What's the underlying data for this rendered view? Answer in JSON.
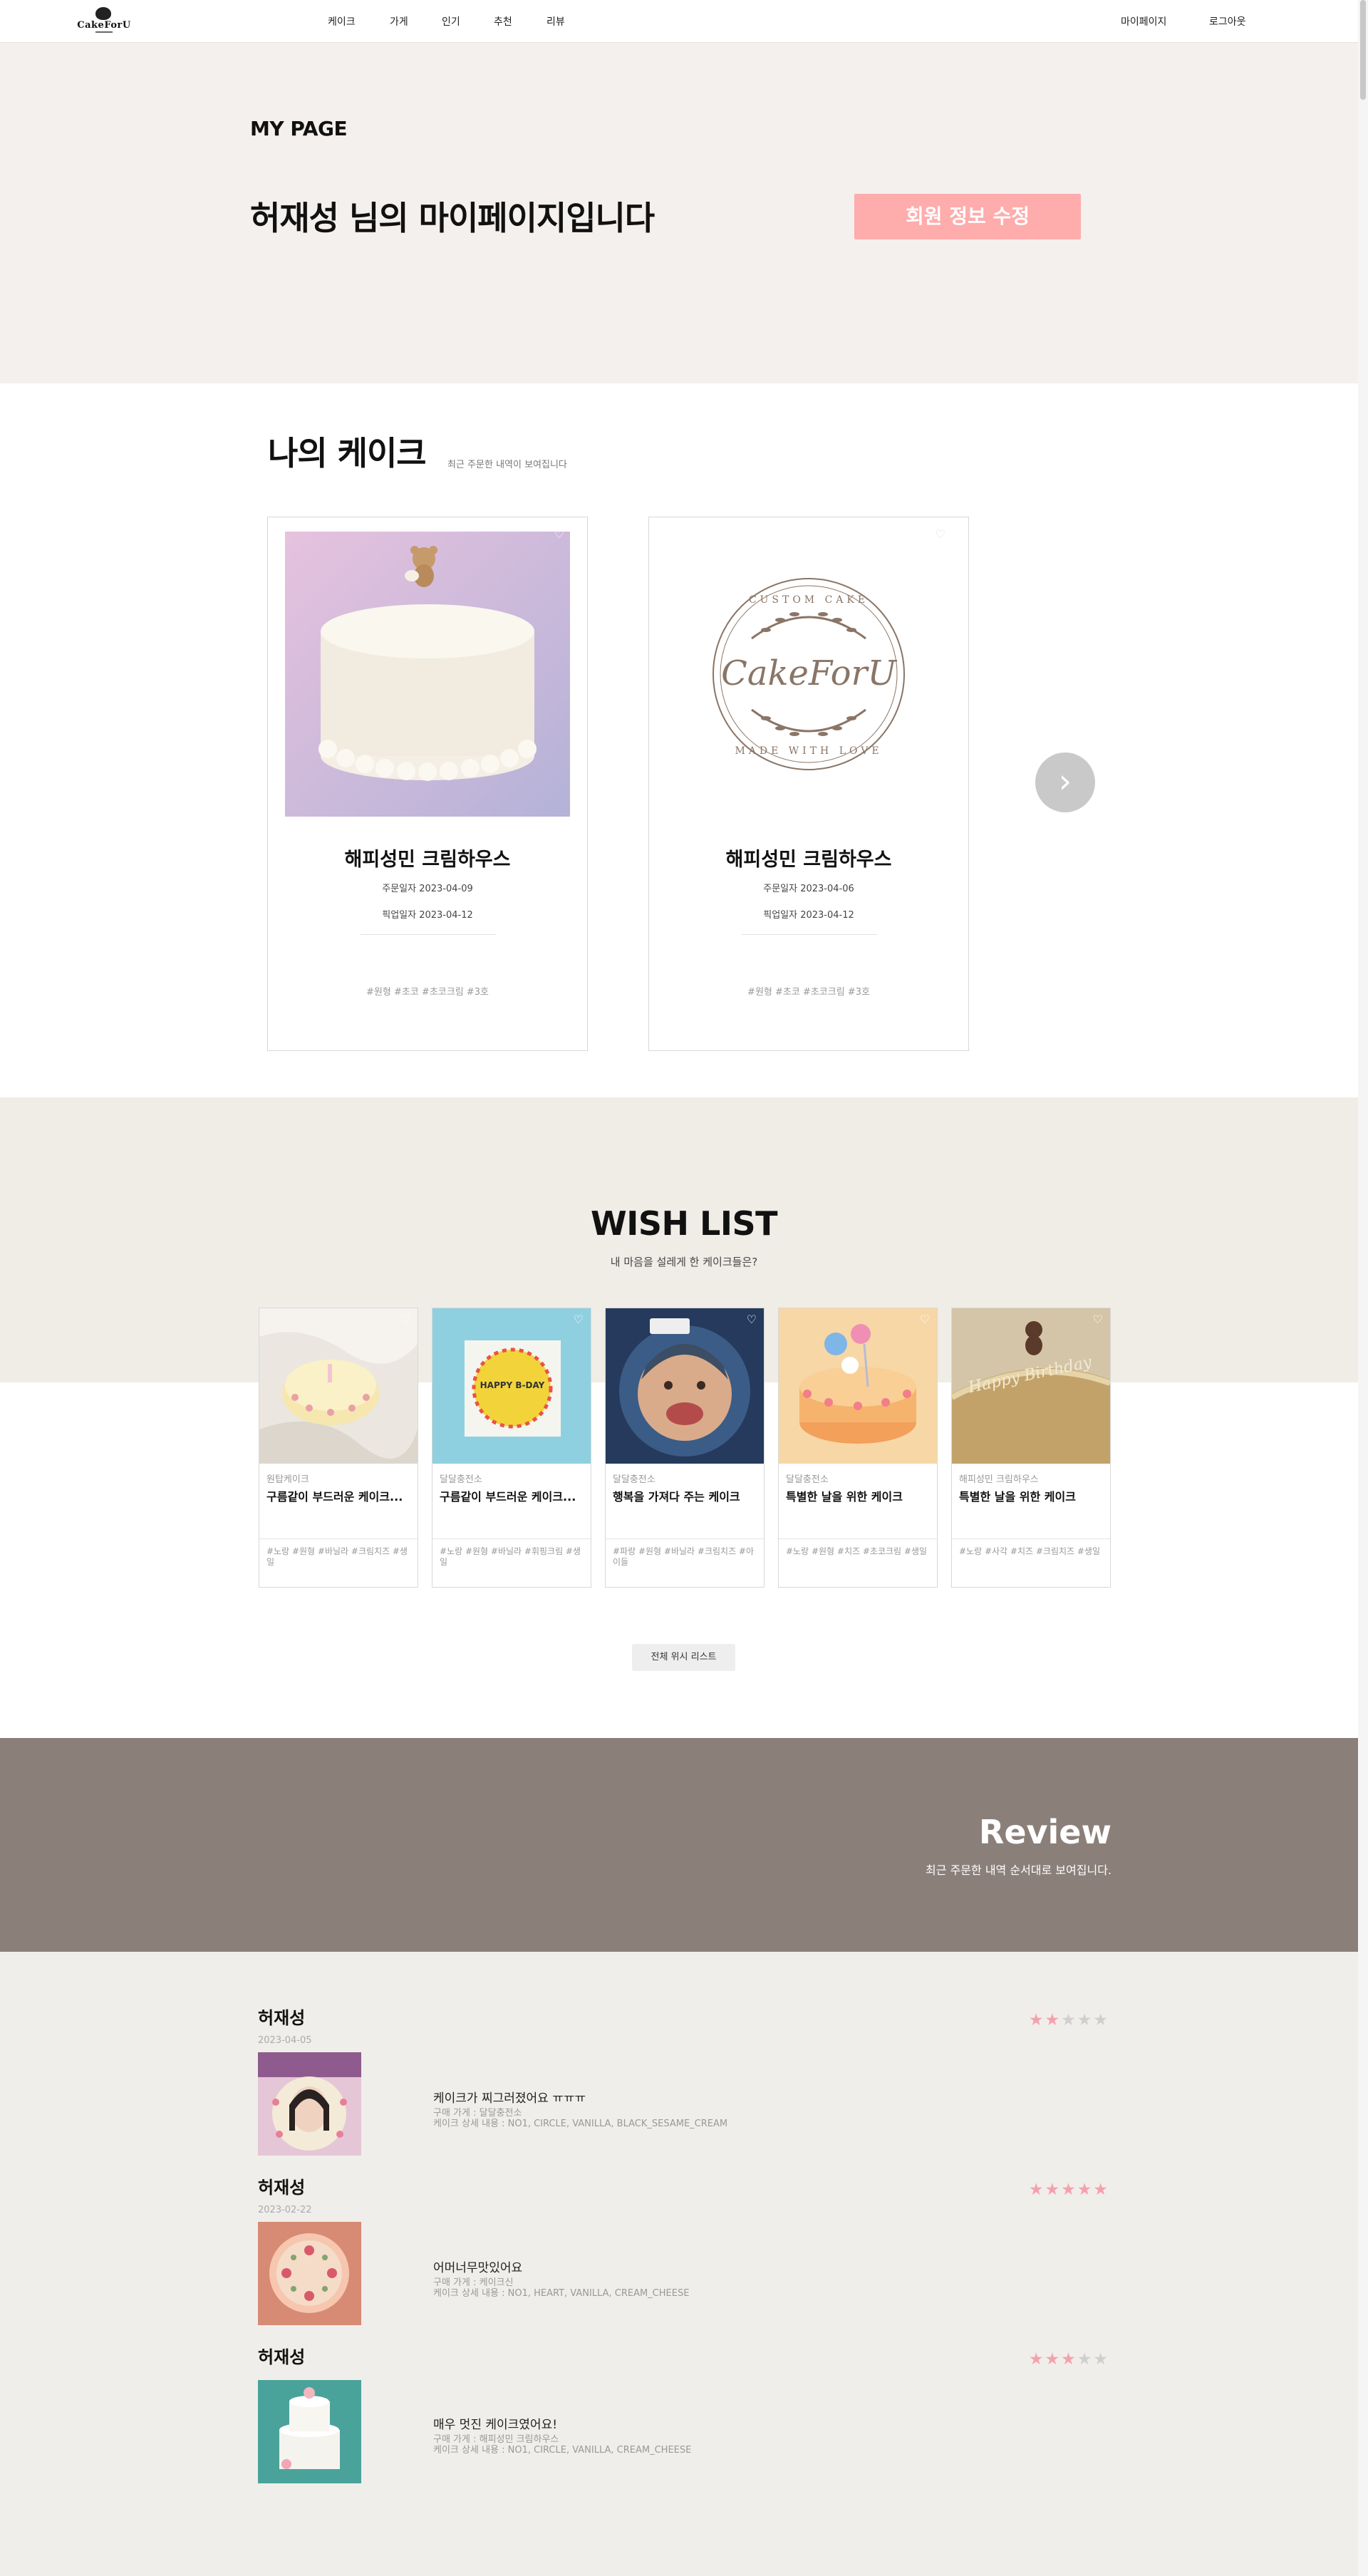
{
  "nav": {
    "logo_text": "CakeForU",
    "links": [
      "케이크",
      "가게",
      "인기",
      "추천",
      "리뷰"
    ],
    "mypage": "마이페이지",
    "logout": "로그아웃"
  },
  "hero": {
    "label": "MY PAGE",
    "title": "허재성 님의 마이페이지입니다",
    "edit_button": "회원 정보 수정"
  },
  "my_cakes": {
    "title": "나의 케이크",
    "subtitle": "최근 주문한 내역이 보여집니다",
    "orders": [
      {
        "shop": "해피성민 크림하우스",
        "order_date": "주문일자 2023-04-09",
        "pickup_date": "픽업일자 2023-04-12",
        "tags": "#원형 #초코 #초코크림 #3호"
      },
      {
        "shop": "해피성민 크림하우스",
        "order_date": "주문일자 2023-04-06",
        "pickup_date": "픽업일자 2023-04-12",
        "tags": "#원형 #초코 #초코크림 #3호",
        "logo": {
          "top": "CUSTOM CAKE",
          "main": "CakeForU",
          "bottom": "MADE WITH LOVE"
        }
      }
    ],
    "next_icon": "chevron-right-icon"
  },
  "wish": {
    "title": "WISH LIST",
    "subtitle": "내 마음을 설레게 한 케이크들은?",
    "items": [
      {
        "shop": "원탑케이크",
        "name": "구름같이 부드러운 케이크...",
        "tags": "#노랑 #원형 #바닐라 #크림치즈 #생일"
      },
      {
        "shop": "달달충전소",
        "name": "구름같이 부드러운 케이크...",
        "tags": "#노랑 #원형 #바닐라 #휘핑크림 #생일"
      },
      {
        "shop": "달달충전소",
        "name": "행복을 가져다 주는 케이크",
        "tags": "#파랑 #원형 #바닐라 #크림치즈 #아이들"
      },
      {
        "shop": "달달충전소",
        "name": "특별한 날을 위한 케이크",
        "tags": "#노랑 #원형 #치즈 #초코크림 #생일"
      },
      {
        "shop": "해피성민 크림하우스",
        "name": "특별한 날을 위한 케이크",
        "tags": "#노랑 #사각 #치즈 #크림치즈 #생일"
      }
    ],
    "cake_texts": [
      "HAPPY B-DAY",
      "Happy Birthday"
    ],
    "button": "전체 위시 리스트"
  },
  "review": {
    "title": "Review",
    "subtitle": "최근 주문한 내역 순서대로 보여집니다.",
    "items": [
      {
        "user": "허재성",
        "date": "2023-04-05",
        "stars": 2,
        "content": "케이크가 찌그러졌어요 ㅠㅠㅠ",
        "store": "구매 가게 : 달달충전소",
        "detail": "케이크 상세 내용 : NO1, CIRCLE, VANILLA, BLACK_SESAME_CREAM"
      },
      {
        "user": "허재성",
        "date": "2023-02-22",
        "stars": 5,
        "content": "어머너무맛있어요",
        "store": "구매 가게 : 케이크신",
        "detail": "케이크 상세 내용 : NO1, HEART, VANILLA, CREAM_CHEESE"
      },
      {
        "user": "허재성",
        "date": "",
        "stars": 3,
        "content": "매우 멋진 케이크였어요!",
        "store": "구매 가게 : 해피성민 크림하우스",
        "detail": "케이크 상세 내용 : NO1, CIRCLE, VANILLA, CREAM_CHEESE"
      }
    ]
  },
  "colors": {
    "accent": "#ffacac",
    "hero_bg": "#f4f0ed",
    "wish_bg": "#efede6",
    "review_banner": "#8a8079",
    "star_on": "#f3a2ad",
    "star_off": "#cfcfcf"
  }
}
